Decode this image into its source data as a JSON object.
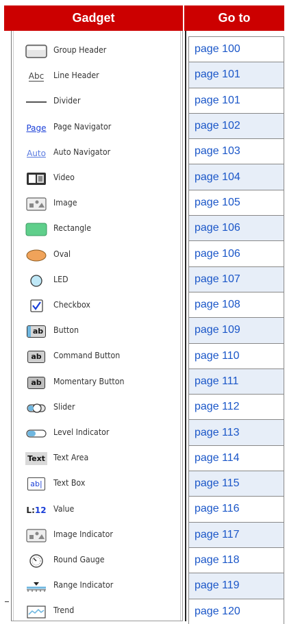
{
  "header": {
    "gadget": "Gadget",
    "goto": "Go to"
  },
  "rows": [
    {
      "gadget": "Group Header",
      "icon": "group-header-icon",
      "page": "page 100"
    },
    {
      "gadget": "Line Header",
      "icon": "line-header-icon",
      "page": "page 101"
    },
    {
      "gadget": "Divider",
      "icon": "divider-icon",
      "page": "page 101"
    },
    {
      "gadget": "Page Navigator",
      "icon": "page-navigator-icon",
      "page": "page 102"
    },
    {
      "gadget": "Auto Navigator",
      "icon": "auto-navigator-icon",
      "page": "page 103"
    },
    {
      "gadget": "Video",
      "icon": "video-icon",
      "page": "page 104"
    },
    {
      "gadget": "Image",
      "icon": "image-icon",
      "page": "page 105"
    },
    {
      "gadget": "Rectangle",
      "icon": "rectangle-icon",
      "page": "page 106"
    },
    {
      "gadget": "Oval",
      "icon": "oval-icon",
      "page": "page 106"
    },
    {
      "gadget": "LED",
      "icon": "led-icon",
      "page": "page 107"
    },
    {
      "gadget": "Checkbox",
      "icon": "checkbox-icon",
      "page": "page 108"
    },
    {
      "gadget": "Button",
      "icon": "button-icon",
      "page": "page 109"
    },
    {
      "gadget": "Command Button",
      "icon": "command-button-icon",
      "page": "page 110"
    },
    {
      "gadget": "Momentary Button",
      "icon": "momentary-button-icon",
      "page": "page 111"
    },
    {
      "gadget": "Slider",
      "icon": "slider-icon",
      "page": "page 112"
    },
    {
      "gadget": "Level Indicator",
      "icon": "level-indicator-icon",
      "page": "page 113"
    },
    {
      "gadget": "Text Area",
      "icon": "text-area-icon",
      "page": "page 114"
    },
    {
      "gadget": "Text Box",
      "icon": "text-box-icon",
      "page": "page 115"
    },
    {
      "gadget": "Value",
      "icon": "value-icon",
      "page": "page 116"
    },
    {
      "gadget": "Image Indicator",
      "icon": "image-indicator-icon",
      "page": "page 117"
    },
    {
      "gadget": "Round Gauge",
      "icon": "round-gauge-icon",
      "page": "page 118"
    },
    {
      "gadget": "Range Indicator",
      "icon": "range-indicator-icon",
      "page": "page 119"
    },
    {
      "gadget": "Trend",
      "icon": "trend-icon",
      "page": "page 120"
    }
  ],
  "icon_text": {
    "line_header": "Abc",
    "page_navigator": "Page",
    "auto_navigator": "Auto",
    "button": "ab",
    "command_button": "ab",
    "momentary_button": "ab",
    "text_area": "Text",
    "text_box": "ab|",
    "value_prefix": "L:",
    "value_number": "12"
  },
  "colors": {
    "header_bg": "#cc0000",
    "header_text": "#ffffff",
    "link": "#1a56c8",
    "shaded_row": "#e7eef8",
    "rectangle_fill": "#5fcf8b",
    "oval_fill": "#f0a35a",
    "led_fill": "#bfe8f7",
    "nav_link": "#1a3fd8"
  }
}
